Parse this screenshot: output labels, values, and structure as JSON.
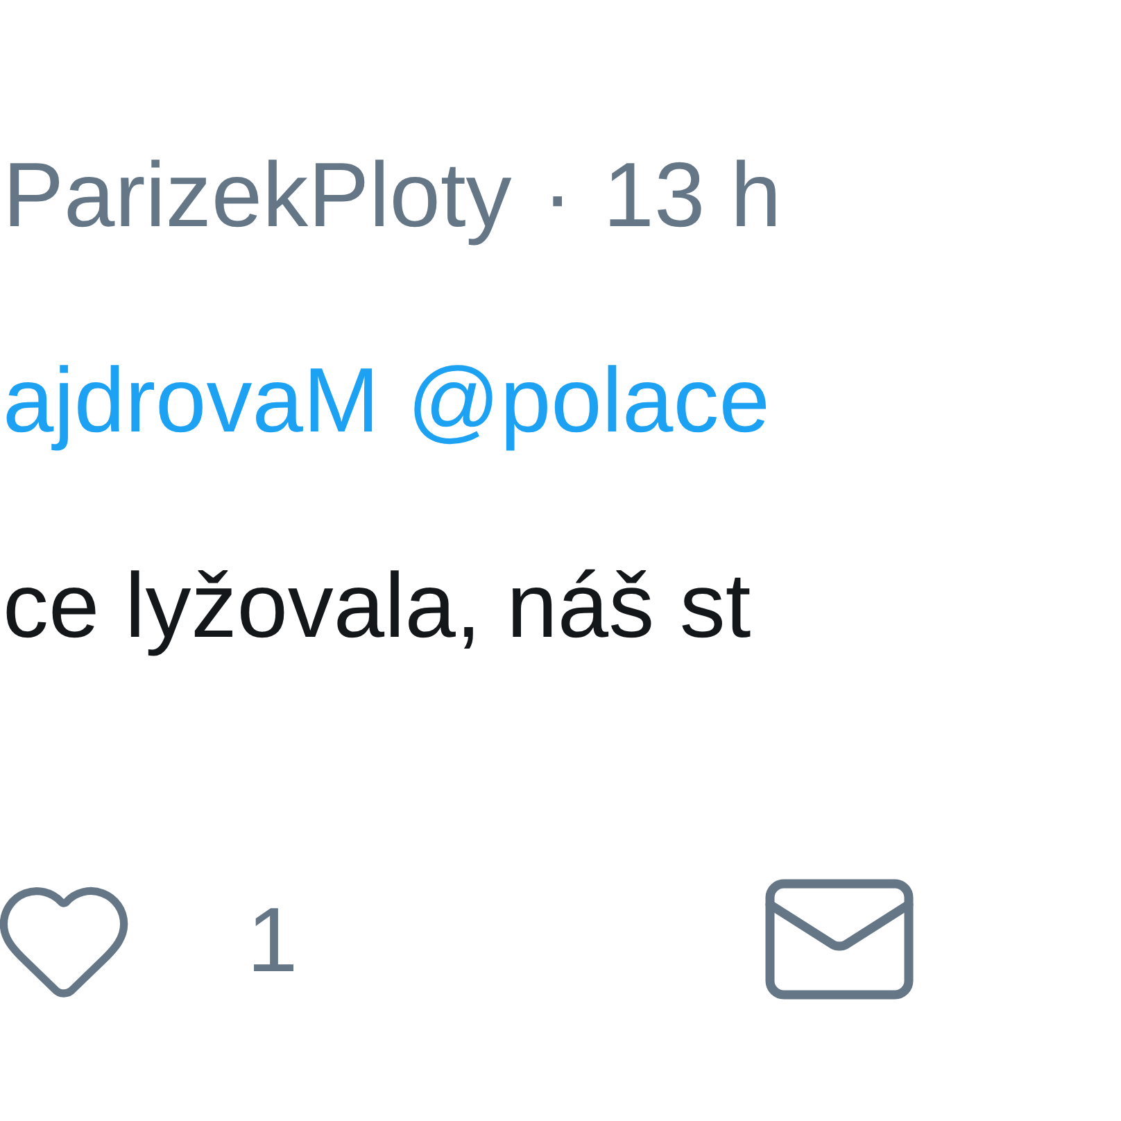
{
  "tweet": {
    "author": "ParizekPloty",
    "separator": "·",
    "time": "13 h",
    "mentions": [
      "ajdrovaM",
      "@polace"
    ],
    "text": "ce lyžovala, náš st",
    "likes": "1"
  }
}
